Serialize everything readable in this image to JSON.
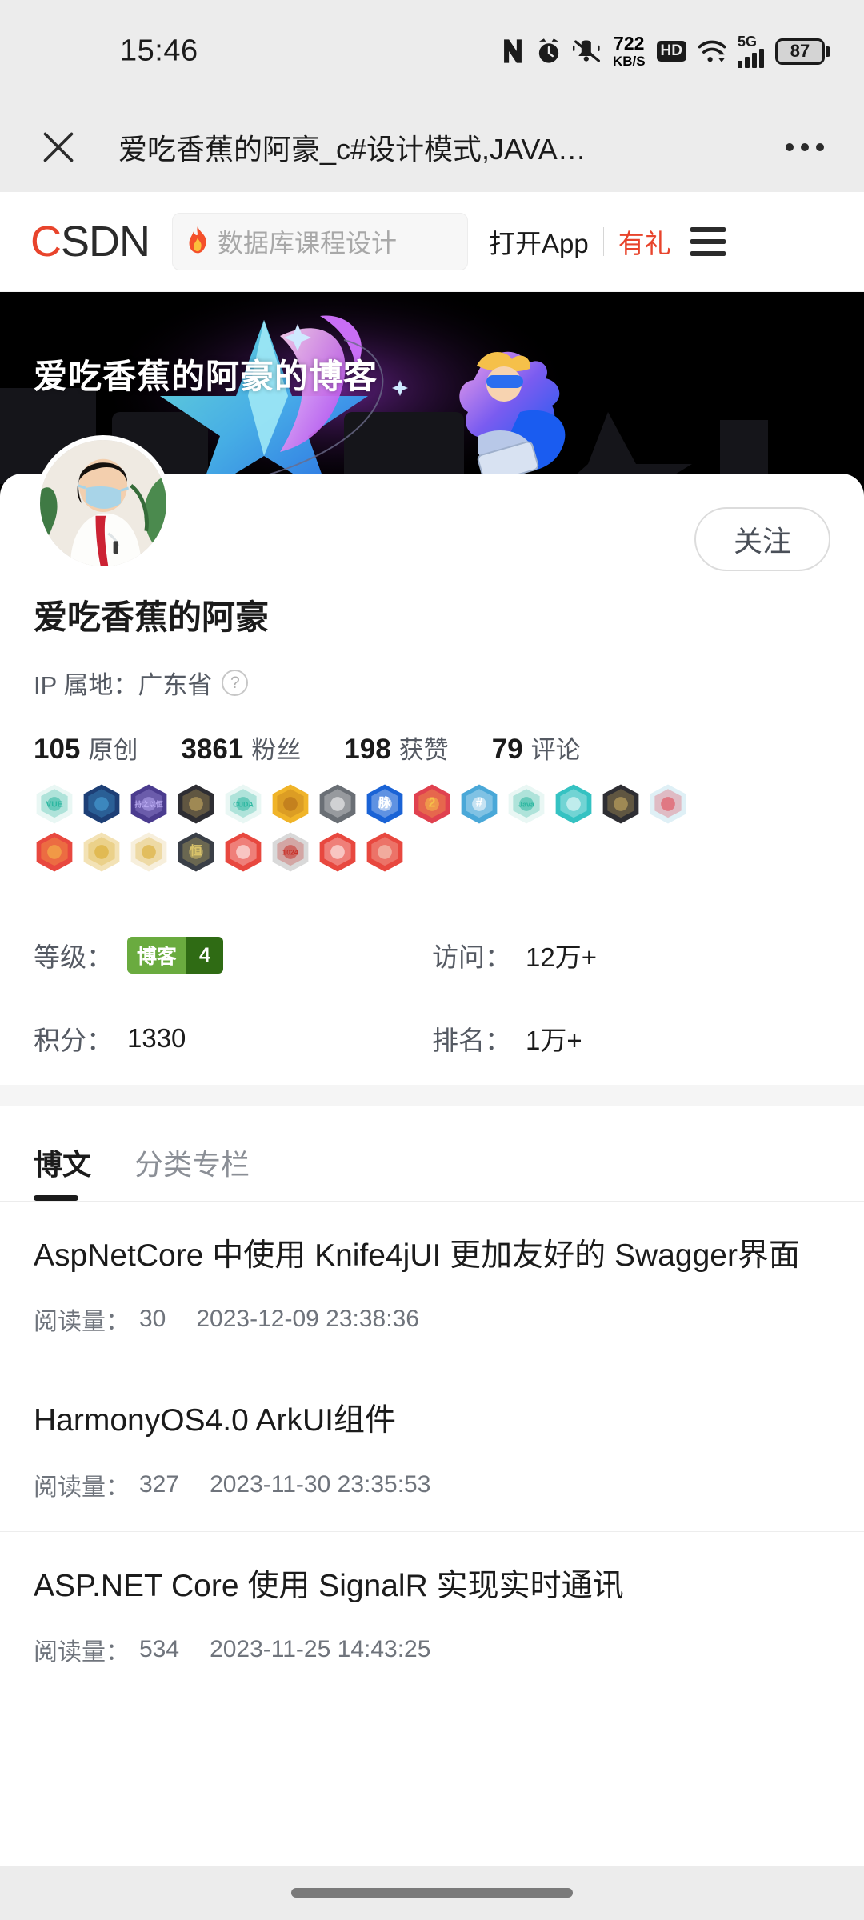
{
  "status_bar": {
    "time": "15:46",
    "network_speed_value": "722",
    "network_speed_unit": "KB/S",
    "hd_label": "HD",
    "network_type": "5G",
    "battery_percent": "87",
    "icons": [
      "nfc-icon",
      "alarm-icon",
      "mute-icon",
      "network-speed-icon",
      "hd-icon",
      "wifi-icon",
      "signal-icon",
      "battery-icon"
    ]
  },
  "browser_bar": {
    "close_icon": "close-icon",
    "page_title": "爱吃香蕉的阿豪_c#设计模式,JAVA…",
    "more_icon": "more-options-icon"
  },
  "csdn_header": {
    "logo_first": "C",
    "logo_rest": "SDN",
    "search_placeholder": "数据库课程设计",
    "search_icon": "fire-icon",
    "open_app_label": "打开App",
    "gift_label": "有礼",
    "menu_icon": "hamburger-menu-icon"
  },
  "banner": {
    "blog_title": "爱吃香蕉的阿豪的博客"
  },
  "profile": {
    "avatar_name": "user-avatar",
    "follow_label": "关注",
    "nickname": "爱吃香蕉的阿豪",
    "ip_label": "IP 属地：广东省",
    "help_icon": "question-mark-icon",
    "stats": [
      {
        "num": "105",
        "label": "原创"
      },
      {
        "num": "3861",
        "label": "粉丝"
      },
      {
        "num": "198",
        "label": "获赞"
      },
      {
        "num": "79",
        "label": "评论"
      }
    ],
    "badges_row1": [
      {
        "name": "vue-badge",
        "color": "#e9f7f4",
        "accent": "#2cb7a0",
        "text": "VUE"
      },
      {
        "name": "blog-expert-badge",
        "color": "#1d3f76",
        "accent": "#4aa8e0",
        "text": ""
      },
      {
        "name": "persistence-badge",
        "color": "#4b3c8f",
        "accent": "#b7a8f0",
        "text": "持之以恒"
      },
      {
        "name": "dark-pen-badge",
        "color": "#2e2e33",
        "accent": "#d4b464",
        "text": ""
      },
      {
        "name": "cuda-badge",
        "color": "#e9f7f4",
        "accent": "#2cb7a0",
        "text": "CUDA"
      },
      {
        "name": "target-badge",
        "color": "#f0b429",
        "accent": "#b06a1a",
        "text": ""
      },
      {
        "name": "github-badge",
        "color": "#6a6f75",
        "accent": "#ffffff",
        "text": ""
      },
      {
        "name": "maimai-badge",
        "color": "#1a63d6",
        "accent": "#ffffff",
        "text": "脉"
      },
      {
        "name": "anniversary-badge",
        "color": "#e0414f",
        "accent": "#f5c04a",
        "text": "2"
      },
      {
        "name": "csharp-badge",
        "color": "#4aa8d8",
        "accent": "#ffffff",
        "text": "#"
      },
      {
        "name": "java-badge",
        "color": "#e9f7f4",
        "accent": "#2cb7a0",
        "text": "Java"
      },
      {
        "name": "comment-badge",
        "color": "#35c2c2",
        "accent": "#ffffff",
        "text": ""
      },
      {
        "name": "code-desk-badge",
        "color": "#2e2e33",
        "accent": "#d4b464",
        "text": ""
      },
      {
        "name": "christmas-badge",
        "color": "#dff0f6",
        "accent": "#e0414f",
        "text": ""
      }
    ],
    "badges_row2": [
      {
        "name": "trophy-red-badge",
        "color": "#e8483f",
        "accent": "#f5c04a",
        "text": ""
      },
      {
        "name": "gold-star-badge",
        "color": "#f3e2b5",
        "accent": "#d9a827",
        "text": ""
      },
      {
        "name": "trophy-gold-badge",
        "color": "#f7efdc",
        "accent": "#d9a827",
        "text": ""
      },
      {
        "name": "perseverance-badge",
        "color": "#3a3f47",
        "accent": "#d9c36a",
        "text": "恒"
      },
      {
        "name": "open-book-badge",
        "color": "#e8483f",
        "accent": "#ffffff",
        "text": ""
      },
      {
        "name": "1024-badge",
        "color": "#d9d9d9",
        "accent": "#c8322a",
        "text": "1024"
      },
      {
        "name": "pen-badge",
        "color": "#e8483f",
        "accent": "#ffffff",
        "text": ""
      },
      {
        "name": "monkey-badge",
        "color": "#e8483f",
        "accent": "#f6d8c8",
        "text": ""
      }
    ],
    "level_grid": [
      {
        "label": "等级：",
        "type": "blog-level",
        "badge_left": "博客",
        "badge_right": "4"
      },
      {
        "label": "访问：",
        "type": "text",
        "value": "12万+"
      },
      {
        "label": "积分：",
        "type": "text",
        "value": "1330"
      },
      {
        "label": "排名：",
        "type": "text",
        "value": "1万+"
      }
    ],
    "level_colors": {
      "left": "#6aab3f",
      "right": "#2f6b14"
    }
  },
  "tabs": [
    {
      "label": "博文",
      "active": true
    },
    {
      "label": "分类专栏",
      "active": false
    }
  ],
  "articles": [
    {
      "title": "AspNetCore 中使用 Knife4jUI 更加友好的 Swagger界面",
      "views_label": "阅读量：",
      "views": "30",
      "date": "2023-12-09 23:38:36"
    },
    {
      "title": "HarmonyOS4.0 ArkUI组件",
      "views_label": "阅读量：",
      "views": "327",
      "date": "2023-11-30 23:35:53"
    },
    {
      "title": "ASP.NET Core 使用 SignalR 实现实时通讯",
      "views_label": "阅读量：",
      "views": "534",
      "date": "2023-11-25 14:43:25"
    }
  ],
  "colors": {
    "csdn_red": "#e8442c",
    "status_bg": "#ececec",
    "text_primary": "#1b1b1b",
    "text_secondary": "#6f747c",
    "tab_active": "#1b1b1b"
  }
}
